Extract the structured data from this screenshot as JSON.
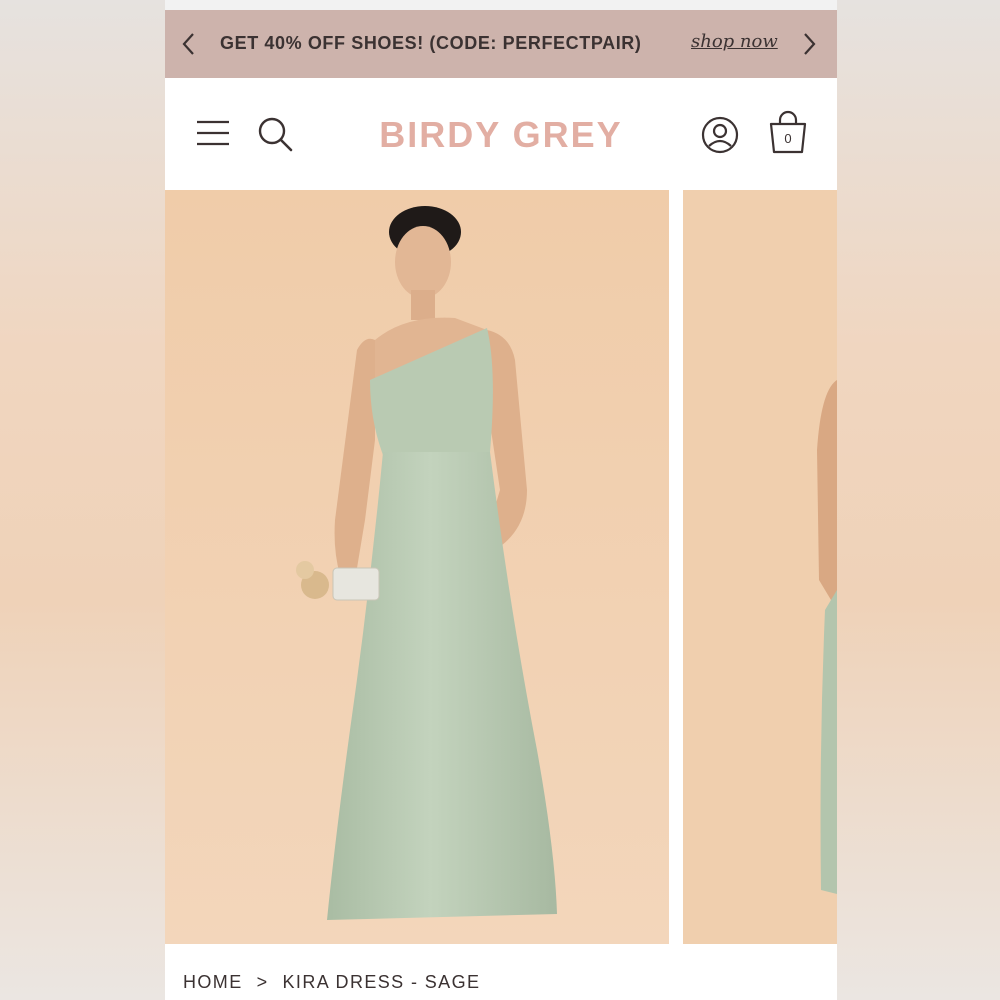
{
  "colors": {
    "promo_bg": "#cdb3ac",
    "brand": "#e2aea3",
    "text": "#3b3232",
    "photo_bg": "#f0cfae",
    "dress": "#b8c9b2"
  },
  "promo": {
    "text": "GET 40% OFF SHOES! (CODE: PERFECTPAIR)",
    "link_label": "shop now",
    "prev_icon": "chevron-left-icon",
    "next_icon": "chevron-right-icon"
  },
  "header": {
    "logo": "BIRDY GREY",
    "menu_icon": "menu-icon",
    "search_icon": "search-icon",
    "account_icon": "account-icon",
    "bag_icon": "shopping-bag-icon",
    "bag_count": "0"
  },
  "gallery": {
    "images": [
      {
        "subject": "model in sage one-shoulder dress"
      },
      {
        "subject": "next product image preview"
      }
    ]
  },
  "breadcrumb": {
    "home": "HOME",
    "separator": ">",
    "current": "KIRA DRESS - SAGE"
  }
}
